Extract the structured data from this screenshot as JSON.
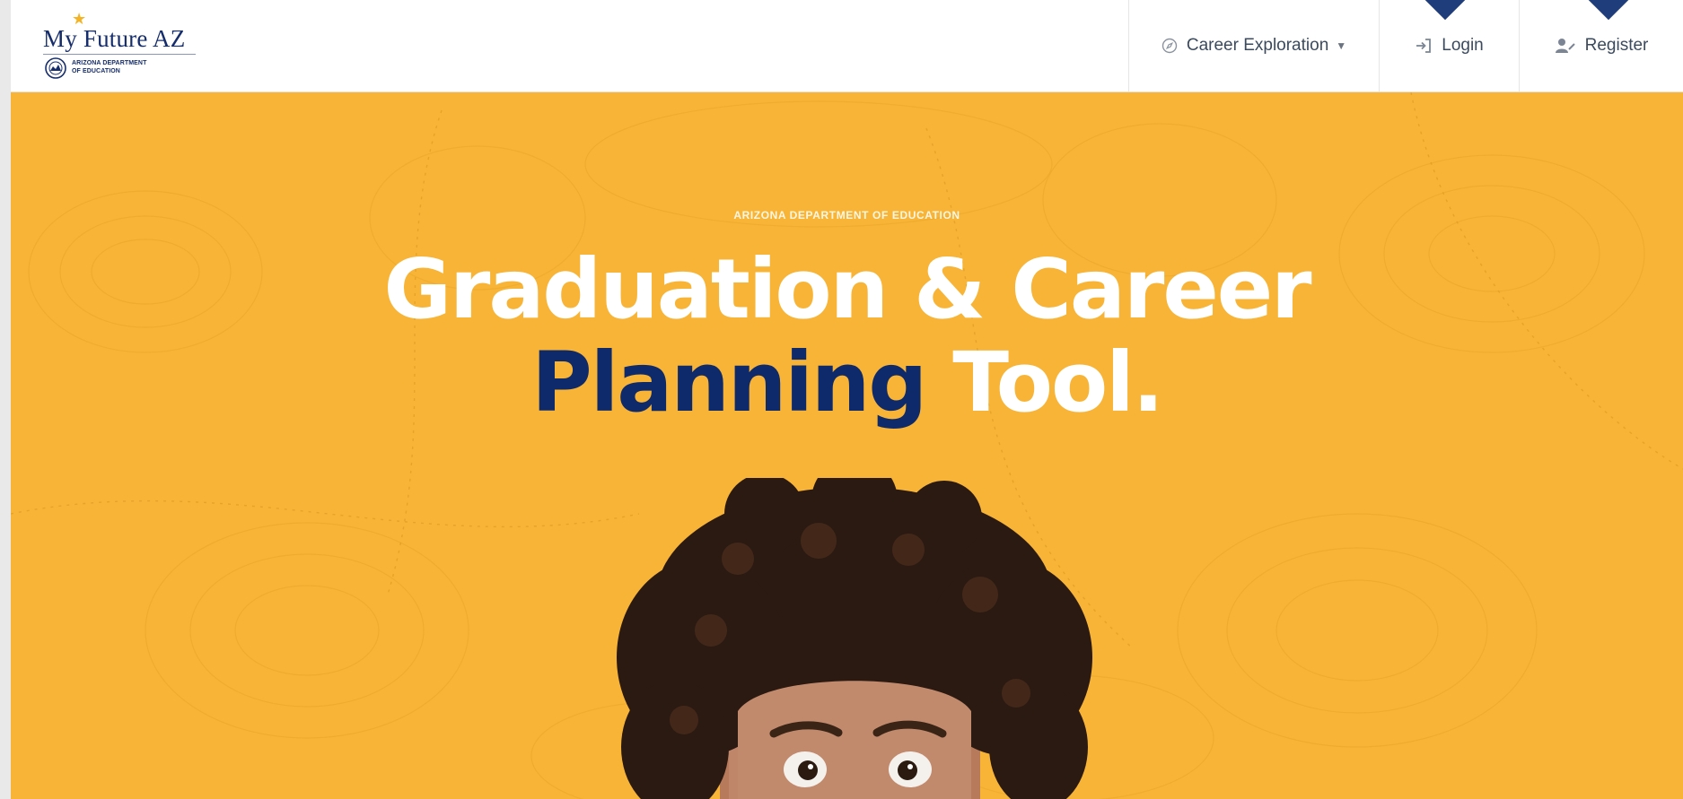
{
  "brand": {
    "title": "My Future AZ",
    "subtitle_line1": "ARIZONA DEPARTMENT",
    "subtitle_line2": "OF EDUCATION",
    "star_color": "#f4b324",
    "text_color": "#162d6b"
  },
  "nav": {
    "career_exploration": {
      "label": "Career Exploration",
      "icon": "compass-icon"
    },
    "login": {
      "label": "Login",
      "icon": "sign-in-icon"
    },
    "register": {
      "label": "Register",
      "icon": "user-plus-icon"
    }
  },
  "hero": {
    "eyebrow": "ARIZONA DEPARTMENT OF EDUCATION",
    "title_line1": "Graduation & Career",
    "title_highlight": "Planning",
    "title_rest": " Tool.",
    "background_color": "#f8b436",
    "highlight_color": "#0f2a6b"
  }
}
